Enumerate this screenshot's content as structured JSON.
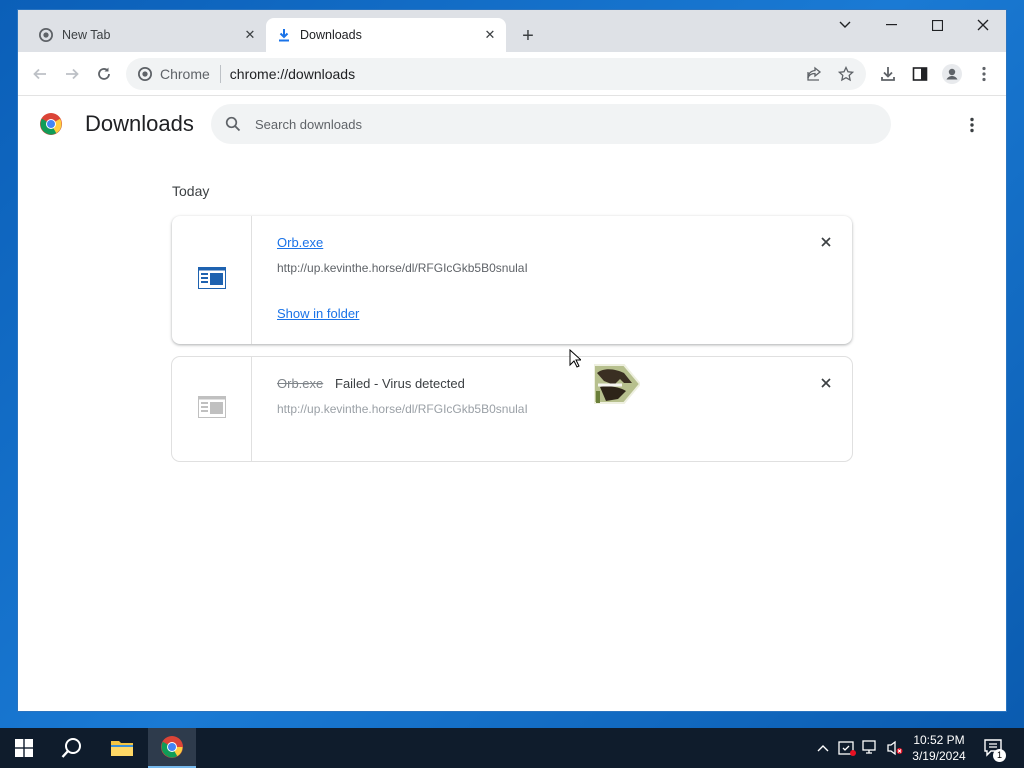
{
  "browser": {
    "tabs": [
      {
        "label": "New Tab",
        "icon": "chrome-favicon",
        "active": false
      },
      {
        "label": "Downloads",
        "icon": "download-icon",
        "active": true
      }
    ],
    "new_tab_symbol": "+",
    "address_bar": {
      "site_chip": "Chrome",
      "url": "chrome://downloads"
    }
  },
  "page": {
    "title": "Downloads",
    "search_placeholder": "Search downloads",
    "section_label": "Today",
    "downloads": [
      {
        "file_name": "Orb.exe",
        "url": "http://up.kevinthe.horse/dl/RFGIcGkb5B0snulaI",
        "action_link": "Show in folder",
        "state": "complete"
      },
      {
        "file_name": "Orb.exe",
        "status": "Failed - Virus detected",
        "url": "http://up.kevinthe.horse/dl/RFGIcGkb5B0snulaI",
        "state": "failed"
      }
    ]
  },
  "taskbar": {
    "time": "10:52 PM",
    "date": "3/19/2024",
    "notification_count": "1"
  },
  "colors": {
    "link": "#1a73e8",
    "taskbar": "#0f1c2c",
    "desktop": "#0b5fb8"
  }
}
